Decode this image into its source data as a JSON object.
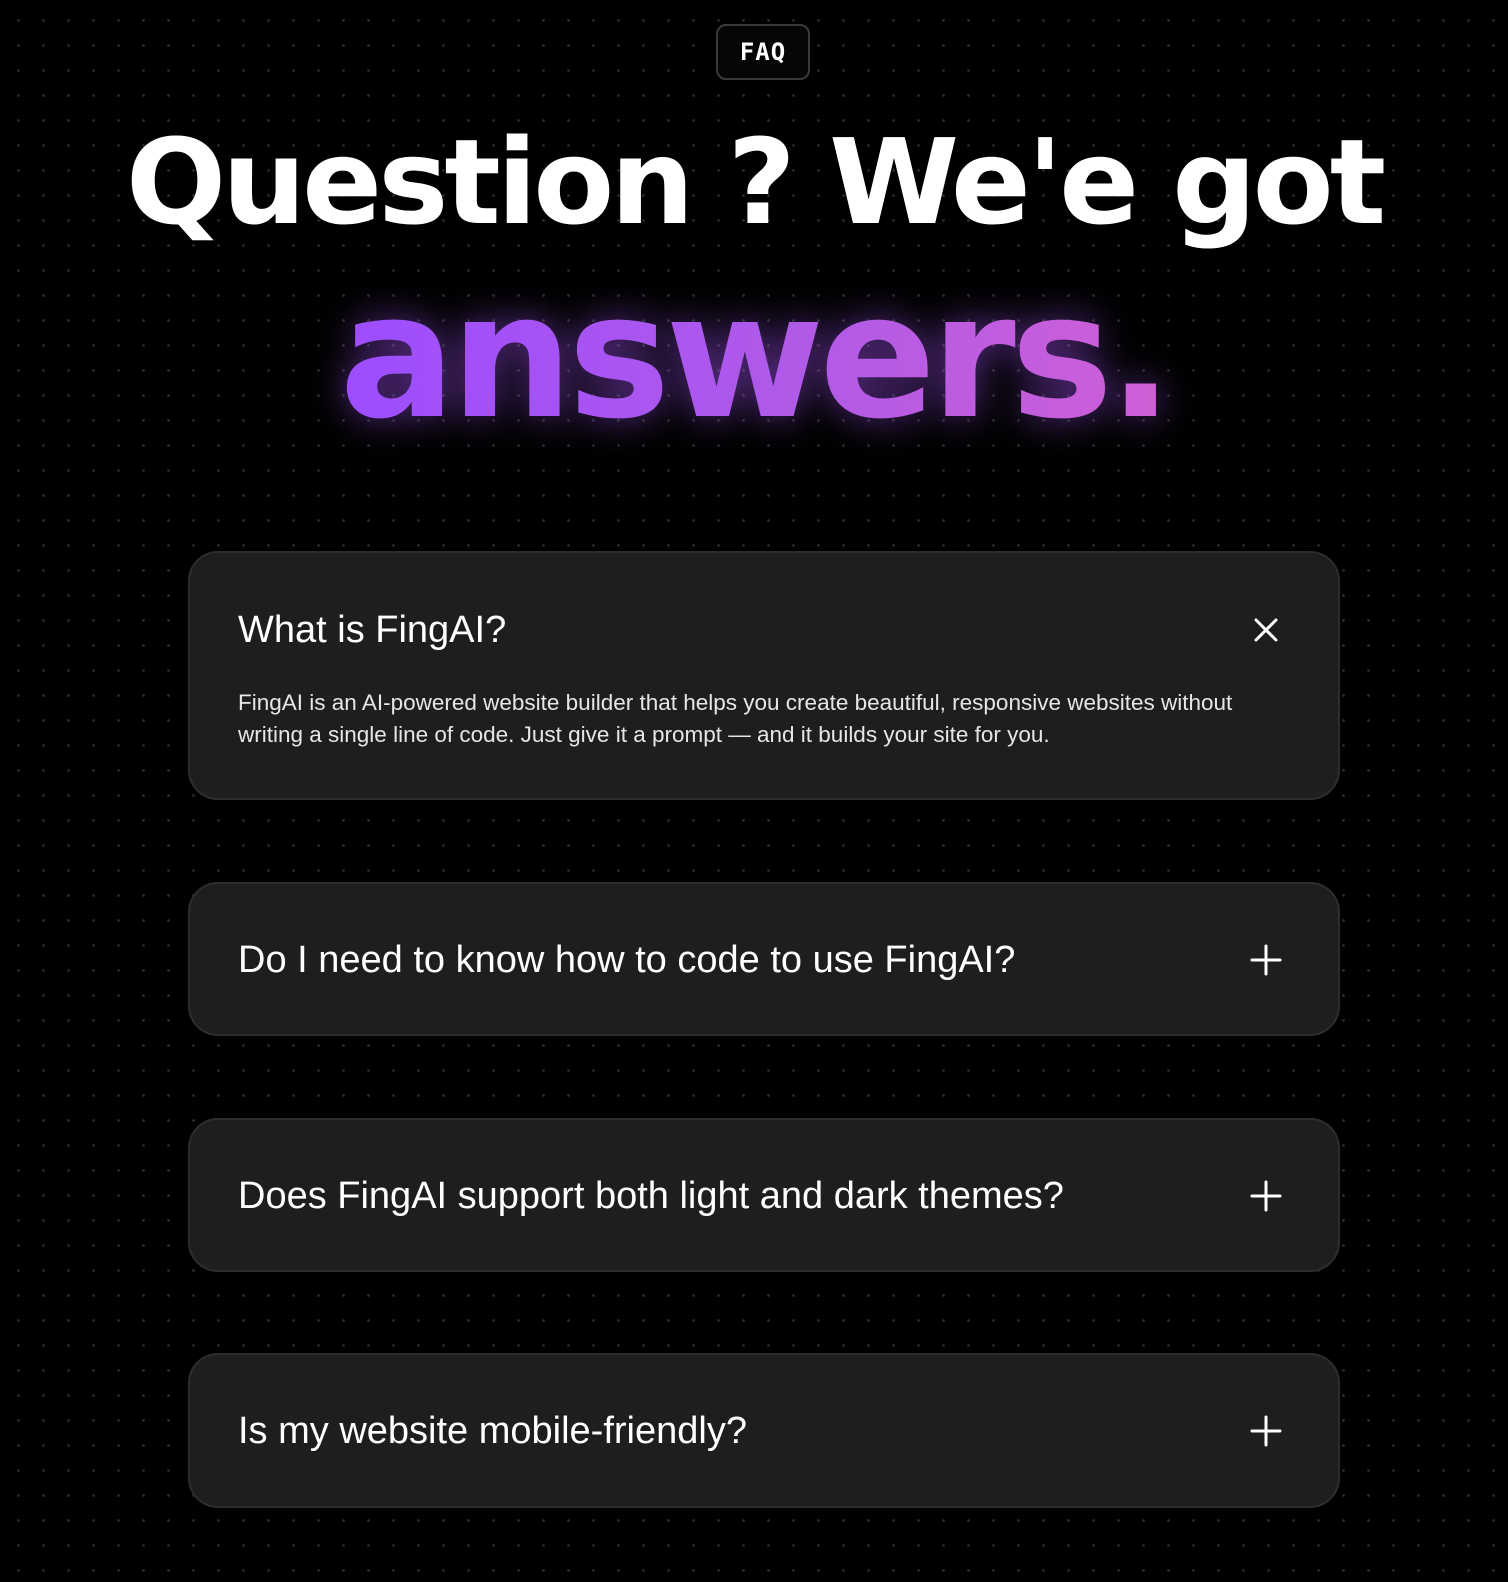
{
  "badge": {
    "label": "FAQ"
  },
  "heading": {
    "line1": "Question ? We'e got",
    "line2": "answers."
  },
  "faq": [
    {
      "question": "What is FingAI?",
      "answer": "FingAI is an AI-powered website builder that helps you create beautiful, responsive websites without writing a single line of code. Just give it a prompt — and it builds your site for you.",
      "expanded": true,
      "toggle_icon": "close-icon"
    },
    {
      "question": "Do I need to know how to code to use FingAI?",
      "expanded": false,
      "toggle_icon": "plus-icon"
    },
    {
      "question": "Does FingAI support both light and dark themes?",
      "expanded": false,
      "toggle_icon": "plus-icon"
    },
    {
      "question": "Is my website mobile-friendly?",
      "expanded": false,
      "toggle_icon": "plus-icon"
    }
  ],
  "colors": {
    "background": "#000000",
    "card": "#1e1e1e",
    "accent_start": "#9d4dff",
    "accent_end": "#cf5fd6"
  }
}
